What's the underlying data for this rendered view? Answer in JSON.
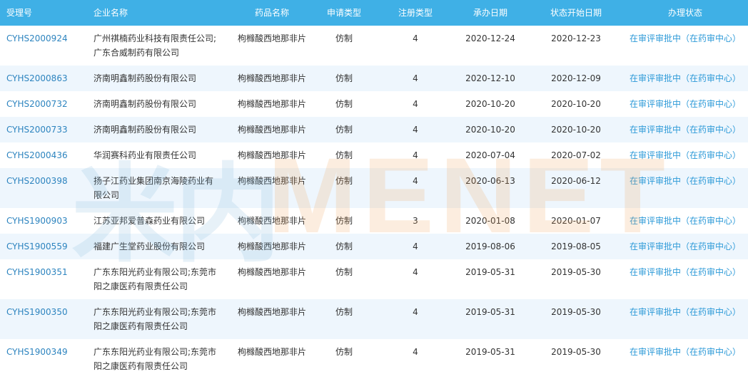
{
  "columns": [
    "受理号",
    "企业名称",
    "药品名称",
    "申请类型",
    "注册类型",
    "承办日期",
    "状态开始日期",
    "办理状态"
  ],
  "rows": [
    {
      "id": "CYHS2000924",
      "company": "广州祺楠药业科技有限责任公司;广东合威制药有限公司",
      "drug": "枸橼酸西地那非片",
      "apply_type": "仿制",
      "reg_type": "4",
      "accept_date": "2020-12-24",
      "status_date": "2020-12-23",
      "status": "在审评审批中（在药审中心）"
    },
    {
      "id": "CYHS2000863",
      "company": "济南明鑫制药股份有限公司",
      "drug": "枸橼酸西地那非片",
      "apply_type": "仿制",
      "reg_type": "4",
      "accept_date": "2020-12-10",
      "status_date": "2020-12-09",
      "status": "在审评审批中（在药审中心）"
    },
    {
      "id": "CYHS2000732",
      "company": "济南明鑫制药股份有限公司",
      "drug": "枸橼酸西地那非片",
      "apply_type": "仿制",
      "reg_type": "4",
      "accept_date": "2020-10-20",
      "status_date": "2020-10-20",
      "status": "在审评审批中（在药审中心）"
    },
    {
      "id": "CYHS2000733",
      "company": "济南明鑫制药股份有限公司",
      "drug": "枸橼酸西地那非片",
      "apply_type": "仿制",
      "reg_type": "4",
      "accept_date": "2020-10-20",
      "status_date": "2020-10-20",
      "status": "在审评审批中（在药审中心）"
    },
    {
      "id": "CYHS2000436",
      "company": "华润赛科药业有限责任公司",
      "drug": "枸橼酸西地那非片",
      "apply_type": "仿制",
      "reg_type": "4",
      "accept_date": "2020-07-04",
      "status_date": "2020-07-02",
      "status": "在审评审批中（在药审中心）"
    },
    {
      "id": "CYHS2000398",
      "company": "扬子江药业集团南京海陵药业有限公司",
      "drug": "枸橼酸西地那非片",
      "apply_type": "仿制",
      "reg_type": "4",
      "accept_date": "2020-06-13",
      "status_date": "2020-06-12",
      "status": "在审评审批中（在药审中心）"
    },
    {
      "id": "CYHS1900903",
      "company": "江苏亚邦爱普森药业有限公司",
      "drug": "枸橼酸西地那非片",
      "apply_type": "仿制",
      "reg_type": "3",
      "accept_date": "2020-01-08",
      "status_date": "2020-01-07",
      "status": "在审评审批中（在药审中心）"
    },
    {
      "id": "CYHS1900559",
      "company": "福建广生堂药业股份有限公司",
      "drug": "枸橼酸西地那非片",
      "apply_type": "仿制",
      "reg_type": "4",
      "accept_date": "2019-08-06",
      "status_date": "2019-08-05",
      "status": "在审评审批中（在药审中心）"
    },
    {
      "id": "CYHS1900351",
      "company": "广东东阳光药业有限公司;东莞市阳之康医药有限责任公司",
      "drug": "枸橼酸西地那非片",
      "apply_type": "仿制",
      "reg_type": "4",
      "accept_date": "2019-05-31",
      "status_date": "2019-05-30",
      "status": "在审评审批中（在药审中心）"
    },
    {
      "id": "CYHS1900350",
      "company": "广东东阳光药业有限公司;东莞市阳之康医药有限责任公司",
      "drug": "枸橼酸西地那非片",
      "apply_type": "仿制",
      "reg_type": "4",
      "accept_date": "2019-05-31",
      "status_date": "2019-05-30",
      "status": "在审评审批中（在药审中心）"
    },
    {
      "id": "CYHS1900349",
      "company": "广东东阳光药业有限公司;东莞市阳之康医药有限责任公司",
      "drug": "枸橼酸西地那非片",
      "apply_type": "仿制",
      "reg_type": "4",
      "accept_date": "2019-05-31",
      "status_date": "2019-05-30",
      "status": "在审评审批中（在药审中心）"
    }
  ],
  "watermark": {
    "han": "米内",
    "latin": "MENET"
  },
  "colors": {
    "header_bg": "#3fb0e6",
    "link": "#2d84bf",
    "status": "#2d9ad8",
    "row_alt": "#eef6fd"
  }
}
